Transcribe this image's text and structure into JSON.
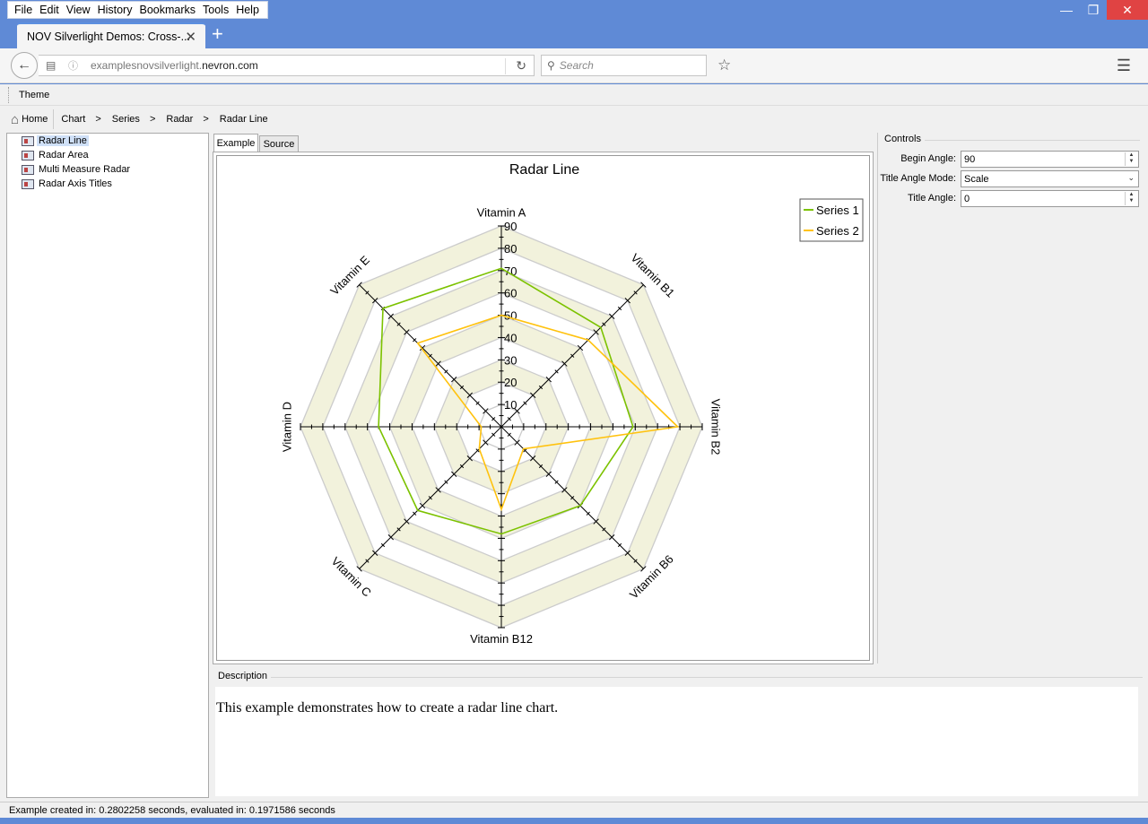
{
  "window": {
    "menu": [
      "File",
      "Edit",
      "View",
      "History",
      "Bookmarks",
      "Tools",
      "Help"
    ],
    "tab_title": "NOV Silverlight Demos: Cross-...",
    "url_prefix": "examplesnovsilverlight.",
    "url_domain": "nevron.com",
    "search_placeholder": "Search"
  },
  "app": {
    "theme_label": "Theme",
    "breadcrumb": {
      "home": "Home",
      "items": [
        "Chart",
        "Series",
        "Radar",
        "Radar Line"
      ],
      "separator": ">"
    },
    "tree": [
      {
        "label": "Radar Line",
        "selected": true
      },
      {
        "label": "Radar Area",
        "selected": false
      },
      {
        "label": "Multi Measure Radar",
        "selected": false
      },
      {
        "label": "Radar Axis Titles",
        "selected": false
      }
    ],
    "tabs": {
      "example": "Example",
      "source": "Source"
    },
    "controls": {
      "title": "Controls",
      "begin_angle_label": "Begin Angle:",
      "begin_angle_value": "90",
      "title_angle_mode_label": "Title Angle Mode:",
      "title_angle_mode_value": "Scale",
      "title_angle_label": "Title Angle:",
      "title_angle_value": "0"
    },
    "description": {
      "title": "Description",
      "text": "This example demonstrates how to create a radar line chart."
    },
    "status": "Example created in: 0.2802258 seconds,  evaluated in: 0.1971586 seconds"
  },
  "chart_data": {
    "type": "radar",
    "title": "Radar Line",
    "categories": [
      "Vitamin A",
      "Vitamin B1",
      "Vitamin B2",
      "Vitamin B6",
      "Vitamin B12",
      "Vitamin C",
      "Vitamin D",
      "Vitamin E"
    ],
    "scale_ticks": [
      "10",
      "20",
      "30",
      "40",
      "50",
      "60",
      "70",
      "80",
      "90"
    ],
    "scale_max": 90,
    "series": [
      {
        "name": "Series 1",
        "color": "#7cc200",
        "values": [
          71,
          63,
          59,
          50,
          48,
          53,
          55,
          75
        ]
      },
      {
        "name": "Series 2",
        "color": "#ffc20e",
        "values": [
          50,
          55,
          79,
          14,
          37,
          14,
          9,
          53
        ]
      }
    ],
    "legend_position": "top-right",
    "stripe_color": "#f2f2dc",
    "grid_color": "#cccccc"
  }
}
